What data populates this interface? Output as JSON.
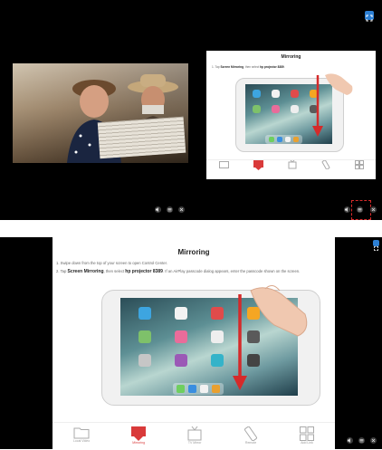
{
  "top": {
    "doc": {
      "title": "Mirroring",
      "line1_prefix": "1. Tap ",
      "line1_bold": "Screen Mirroring",
      "line1_mid": ", then select ",
      "line1_bold2": "hp projector 8389",
      "line1_suffix": "."
    },
    "tabs": [
      "",
      "",
      "",
      "",
      ""
    ]
  },
  "bottom": {
    "doc": {
      "title": "Mirroring",
      "line1": "1. Swipe down from the top of your screen to open Control Center.",
      "line2_prefix": "2. Tap ",
      "line2_bold": "Screen Mirroring",
      "line2_mid": ", then select ",
      "line2_bold2": "hp projector 8389",
      "line2_suffix": ". If an AirPlay passcode dialog appears, enter the passcode shown on the screen."
    },
    "tabs": [
      "Local Video",
      "Mirroring",
      "TV Mirror",
      "Remote",
      "Add Link"
    ]
  },
  "colors": {
    "accent": "#d93a3a",
    "expand": "#2d7fd3",
    "background": "#000000"
  }
}
